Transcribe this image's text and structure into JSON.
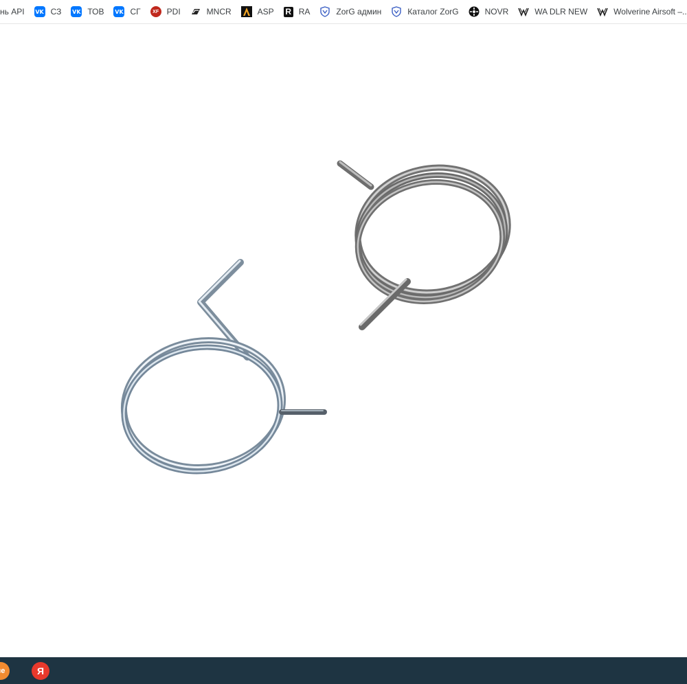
{
  "bookmarks_bar": {
    "items": [
      {
        "label": "нь API",
        "icon": "none"
      },
      {
        "label": "СЗ",
        "icon": "vk-icon"
      },
      {
        "label": "ТОВ",
        "icon": "vk-icon"
      },
      {
        "label": "СГ",
        "icon": "vk-icon"
      },
      {
        "label": "PDI",
        "icon": "xf-icon"
      },
      {
        "label": "MNCR",
        "icon": "mncr-icon"
      },
      {
        "label": "ASP",
        "icon": "asp-icon"
      },
      {
        "label": "RA",
        "icon": "r-icon"
      },
      {
        "label": "ZorG админ",
        "icon": "zorg-shield-icon"
      },
      {
        "label": "Каталог ZorG",
        "icon": "zorg-shield-icon"
      },
      {
        "label": "NOVR",
        "icon": "novr-icon"
      },
      {
        "label": "WA DLR NEW",
        "icon": "wa-icon"
      },
      {
        "label": "Wolverine Airsoft –...",
        "icon": "wa-icon"
      }
    ],
    "vk_icon_text": "VK",
    "xf_icon_text": "XF",
    "r_icon_text": "R"
  },
  "image": {
    "subject": "two-torsion-springs"
  },
  "taskbar": {
    "apps": [
      {
        "icon": "partial-app-icon",
        "text": "не"
      },
      {
        "icon": "yandex-browser-icon",
        "text": "Я"
      }
    ],
    "colors": {
      "background": "#1e3442",
      "yandex": "#e8392c"
    }
  }
}
